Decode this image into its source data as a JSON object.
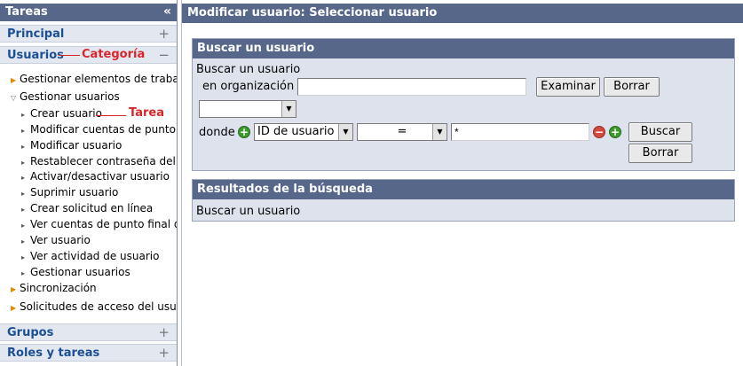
{
  "sidebar": {
    "title": "Tareas",
    "collapse_glyph": "«",
    "categories": {
      "principal": "Principal",
      "usuarios": "Usuarios",
      "grupos": "Grupos",
      "roles": "Roles y tareas"
    },
    "toggle_plus": "+",
    "toggle_minus": "−",
    "annotations": {
      "categoria": "Categoría",
      "tarea": "Tarea"
    },
    "tree": [
      "Gestionar elementos de trabajo",
      "Gestionar usuarios",
      "Crear usuario",
      "Modificar cuentas de punto final",
      "Modificar usuario",
      "Restablecer contraseña del usuario",
      "Activar/desactivar usuario",
      "Suprimir usuario",
      "Crear solicitud en línea",
      "Ver cuentas de punto final del usuario",
      "Ver usuario",
      "Ver actividad de usuario",
      "Gestionar usuarios",
      "Sincronización",
      "Solicitudes de acceso del usuario"
    ]
  },
  "main": {
    "title": "Modificar usuario: Seleccionar usuario",
    "search_panel": {
      "header": "Buscar un usuario",
      "label_line1": "Buscar un usuario",
      "label_line2": "en organización",
      "org_value": "",
      "examinar": "Examinar",
      "borrar": "Borrar",
      "scope_value": "",
      "donde": "donde",
      "attribute": "ID de usuario",
      "operator": "=",
      "value": "*",
      "buscar": "Buscar",
      "borrar2": "Borrar"
    },
    "results_panel": {
      "header": "Resultados de la búsqueda",
      "text": "Buscar un usuario"
    }
  },
  "colors": {
    "header_bg": "#56678a",
    "panel_bg": "#dde2ec",
    "category_text": "#1b4f93",
    "annotation": "#d7262b"
  }
}
